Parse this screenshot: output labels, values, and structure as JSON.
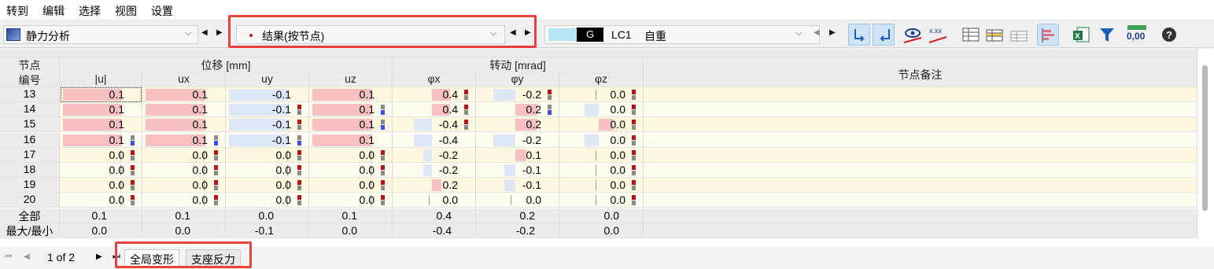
{
  "menu": [
    "转到",
    "编辑",
    "选择",
    "视图",
    "设置"
  ],
  "toolbar": {
    "analysis": "静力分析",
    "results": "结果(按节点)",
    "lc_code": "G",
    "lc_name": "LC1",
    "lc_desc": "自重",
    "decimals": "0,00"
  },
  "colors": {
    "positive": "#f8c0c3",
    "negative": "#dde7f8",
    "highlight": "#e8423f",
    "row_yellow": "#fff9df"
  },
  "table": {
    "node_header_1": "节点",
    "node_header_2": "编号",
    "group_displacement": "位移 [mm]",
    "group_rotation": "转动 [mrad]",
    "columns": [
      "|u|",
      "ux",
      "uy",
      "uz",
      "φx",
      "φy",
      "φz"
    ],
    "comment_header": "节点备注",
    "rows": [
      {
        "node": "13",
        "values": [
          "0.1",
          "0.1",
          "-0.1",
          "0.1",
          "0.4",
          "-0.2",
          "0.0"
        ],
        "fractions": [
          1,
          1,
          -1,
          1,
          0.5,
          -0.6,
          0
        ]
      },
      {
        "node": "14",
        "values": [
          "0.1",
          "0.1",
          "-0.1",
          "0.1",
          "0.4",
          "0.2",
          "0.0"
        ],
        "fractions": [
          1,
          1,
          -1,
          1,
          0.5,
          0.6,
          -0.4
        ]
      },
      {
        "node": "15",
        "values": [
          "0.1",
          "0.1",
          "-0.1",
          "0.1",
          "-0.4",
          "0.2",
          "0.0"
        ],
        "fractions": [
          1,
          1,
          -1,
          1,
          -0.5,
          0.6,
          0.4
        ]
      },
      {
        "node": "16",
        "values": [
          "0.1",
          "0.1",
          "-0.1",
          "0.1",
          "-0.4",
          "-0.2",
          "0.0"
        ],
        "fractions": [
          1,
          1,
          -1,
          1,
          -0.5,
          -0.6,
          -0.4
        ]
      },
      {
        "node": "17",
        "values": [
          "0.0",
          "0.0",
          "0.0",
          "0.0",
          "-0.2",
          "0.1",
          "0.0"
        ],
        "fractions": [
          0,
          0,
          0,
          0,
          -0.25,
          0.3,
          0
        ]
      },
      {
        "node": "18",
        "values": [
          "0.0",
          "0.0",
          "0.0",
          "0.0",
          "-0.2",
          "-0.1",
          "0.0"
        ],
        "fractions": [
          0,
          0,
          0,
          0,
          -0.25,
          -0.3,
          0
        ]
      },
      {
        "node": "19",
        "values": [
          "0.0",
          "0.0",
          "0.0",
          "0.0",
          "0.2",
          "-0.1",
          "0.0"
        ],
        "fractions": [
          0,
          0,
          0,
          0,
          0.25,
          -0.3,
          0
        ]
      },
      {
        "node": "20",
        "values": [
          "0.0",
          "0.0",
          "0.0",
          "0.0",
          "0.0",
          "0.0",
          "0.0"
        ],
        "fractions": [
          0,
          0,
          0,
          0,
          0,
          0,
          0
        ]
      }
    ],
    "totals_label_1": "全部",
    "totals_label_2": "最大/最小",
    "totals_max": [
      "0.1",
      "0.1",
      "0.0",
      "0.1",
      "0.4",
      "0.2",
      "0.0"
    ],
    "totals_min": [
      "0.0",
      "0.0",
      "-0.1",
      "0.0",
      "-0.4",
      "-0.2",
      "0.0"
    ]
  },
  "pager": {
    "text": "1 of 2"
  },
  "tabs": [
    "全局变形",
    "支座反力"
  ]
}
